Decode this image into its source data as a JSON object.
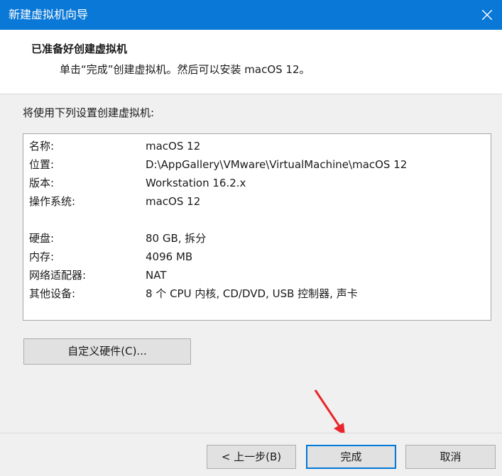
{
  "window": {
    "title": "新建虚拟机向导",
    "close_icon": "close-icon"
  },
  "header": {
    "title": "已准备好创建虚拟机",
    "subtitle": "单击“完成”创建虚拟机。然后可以安装 macOS 12。"
  },
  "intro": "将使用下列设置创建虚拟机:",
  "settings": [
    {
      "key": "名称:",
      "value": "macOS 12"
    },
    {
      "key": "位置:",
      "value": "D:\\AppGallery\\VMware\\VirtualMachine\\macOS 12"
    },
    {
      "key": "版本:",
      "value": "Workstation 16.2.x"
    },
    {
      "key": "操作系统:",
      "value": "macOS 12"
    },
    {
      "key": "硬盘:",
      "value": "80 GB, 拆分"
    },
    {
      "key": "内存:",
      "value": "4096 MB"
    },
    {
      "key": "网络适配器:",
      "value": "NAT"
    },
    {
      "key": "其他设备:",
      "value": "8 个 CPU 内核, CD/DVD, USB 控制器, 声卡"
    }
  ],
  "buttons": {
    "customize": "自定义硬件(C)...",
    "back": "< 上一步(B)",
    "finish": "完成",
    "cancel": "取消"
  },
  "colors": {
    "titlebar": "#0a78d7",
    "annotation_arrow": "#e8262b",
    "focus_border": "#0078d7"
  }
}
